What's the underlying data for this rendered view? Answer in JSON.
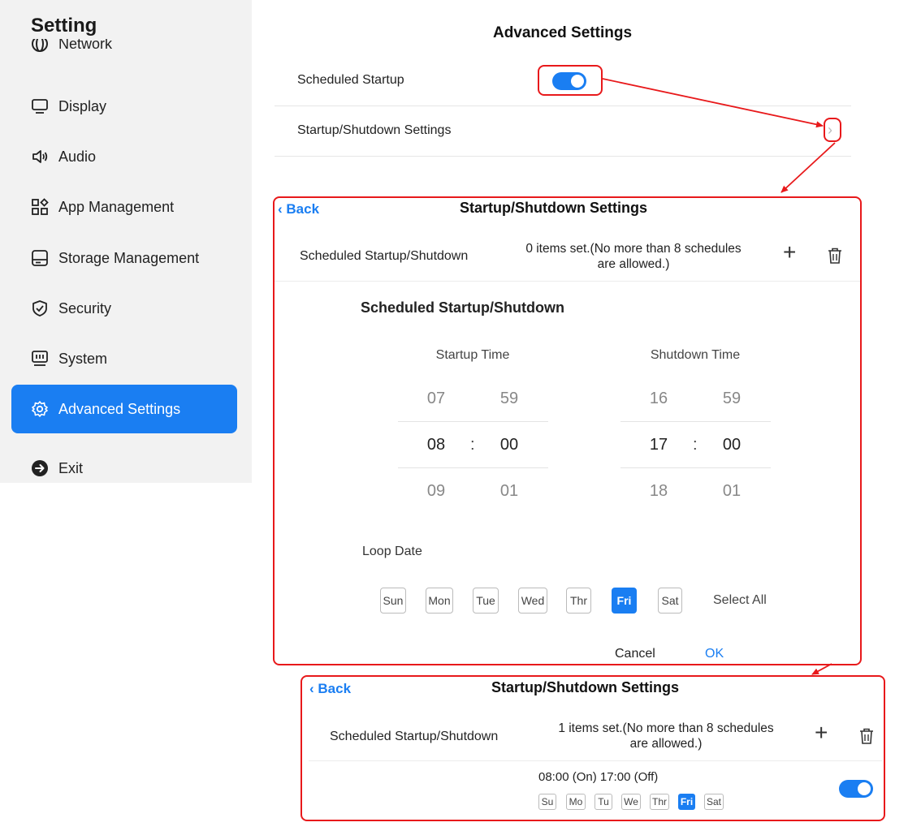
{
  "sidebar": {
    "title": "Setting",
    "partial_item": "Network",
    "items": [
      {
        "label": "Display",
        "icon": "monitor-icon"
      },
      {
        "label": "Audio",
        "icon": "speaker-icon"
      },
      {
        "label": "App Management",
        "icon": "apps-icon"
      },
      {
        "label": "Storage Management",
        "icon": "storage-icon"
      },
      {
        "label": "Security",
        "icon": "shield-check-icon"
      },
      {
        "label": "System",
        "icon": "system-icon"
      },
      {
        "label": "Advanced Settings",
        "icon": "gear-icon",
        "active": true
      },
      {
        "label": "Exit",
        "icon": "exit-icon"
      }
    ]
  },
  "main": {
    "title": "Advanced Settings",
    "scheduled_startup_label": "Scheduled Startup",
    "scheduled_startup_enabled": true,
    "startup_shutdown_label": "Startup/Shutdown Settings"
  },
  "dialog": {
    "back": "Back",
    "title": "Startup/Shutdown Settings",
    "schedule_label": "Scheduled Startup/Shutdown",
    "count_line1": "0 items set.(No more than 8 schedules",
    "count_line2": "are allowed.)",
    "editor_title": "Scheduled Startup/Shutdown",
    "startup_time_label": "Startup Time",
    "shutdown_time_label": "Shutdown Time",
    "startup": {
      "hours": [
        "07",
        "08",
        "09"
      ],
      "minutes": [
        "59",
        "00",
        "01"
      ]
    },
    "shutdown": {
      "hours": [
        "16",
        "17",
        "18"
      ],
      "minutes": [
        "59",
        "00",
        "01"
      ]
    },
    "colon": ":",
    "loop_date_label": "Loop Date",
    "days": [
      "Sun",
      "Mon",
      "Tue",
      "Wed",
      "Thr",
      "Fri",
      "Sat"
    ],
    "selected_day": "Fri",
    "select_all": "Select All",
    "cancel": "Cancel",
    "ok": "OK"
  },
  "result": {
    "back": "Back",
    "title": "Startup/Shutdown Settings",
    "schedule_label": "Scheduled Startup/Shutdown",
    "count_line1": "1 items set.(No more than 8 schedules",
    "count_line2": "are allowed.)",
    "entry_time": "08:00 (On) 17:00 (Off)",
    "mini_days": [
      "Su",
      "Mo",
      "Tu",
      "We",
      "Thr",
      "Fri",
      "Sat"
    ],
    "selected_day": "Fri",
    "entry_enabled": true
  },
  "colors": {
    "accent": "#1a7ef2",
    "highlight": "#e8191b",
    "sidebar_bg": "#f2f2f2"
  }
}
